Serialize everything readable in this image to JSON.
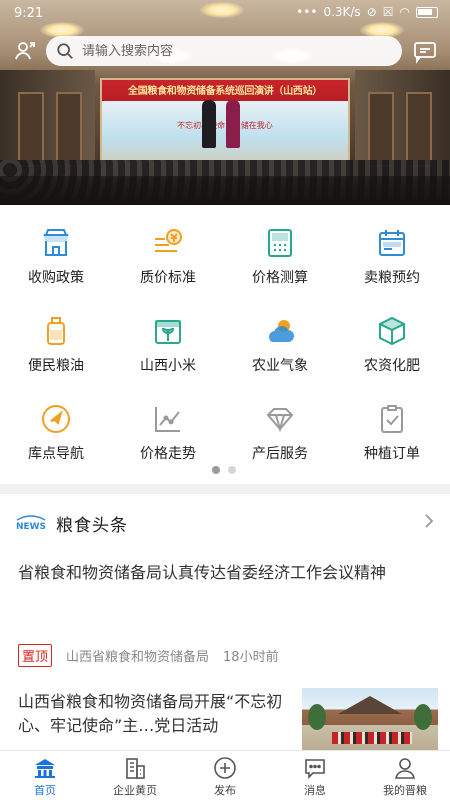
{
  "status_bar": {
    "time": "9:21",
    "network_speed": "0.3K/s",
    "battery_label": ""
  },
  "search": {
    "placeholder": "请输入搜索内容"
  },
  "banner": {
    "headline": "全国粮食和物资储备系统巡回演讲（山西站）",
    "subline": "不忘初心使命 · 粮储在我心"
  },
  "grid_items": [
    {
      "label": "收购政策",
      "icon": "shop-icon"
    },
    {
      "label": "质价标准",
      "icon": "yuan-scale-icon"
    },
    {
      "label": "价格测算",
      "icon": "calculator-icon"
    },
    {
      "label": "卖粮预约",
      "icon": "calendar-icon"
    },
    {
      "label": "便民粮油",
      "icon": "oil-bottle-icon"
    },
    {
      "label": "山西小米",
      "icon": "millet-icon"
    },
    {
      "label": "农业气象",
      "icon": "weather-icon"
    },
    {
      "label": "农资化肥",
      "icon": "box-icon"
    },
    {
      "label": "库点导航",
      "icon": "navigation-icon"
    },
    {
      "label": "价格走势",
      "icon": "trend-chart-icon"
    },
    {
      "label": "产后服务",
      "icon": "diamond-icon"
    },
    {
      "label": "种植订单",
      "icon": "clipboard-check-icon"
    }
  ],
  "news": {
    "badge": "NEWS",
    "section_title": "粮食头条",
    "articles": [
      {
        "title": "省粮食和物资储备局认真传达省委经济工作会议精神",
        "tag": "置顶",
        "source": "山西省粮食和物资储备局",
        "time": "18小时前"
      },
      {
        "title": "山西省粮食和物资储备局开展“不忘初心、牢记使命”主…党日活动"
      }
    ]
  },
  "tabbar": [
    {
      "label": "首页",
      "icon": "home-icon",
      "active": true
    },
    {
      "label": "企业黄页",
      "icon": "building-icon",
      "active": false
    },
    {
      "label": "发布",
      "icon": "plus-circle-icon",
      "active": false
    },
    {
      "label": "消息",
      "icon": "chat-icon",
      "active": false
    },
    {
      "label": "我的晋粮",
      "icon": "user-icon",
      "active": false
    }
  ],
  "colors": {
    "accent": "#1a73d9",
    "icon_blue": "#2e8bd6",
    "icon_orange": "#f0a020",
    "icon_green": "#27a88f",
    "pin_red": "#d9251d"
  }
}
